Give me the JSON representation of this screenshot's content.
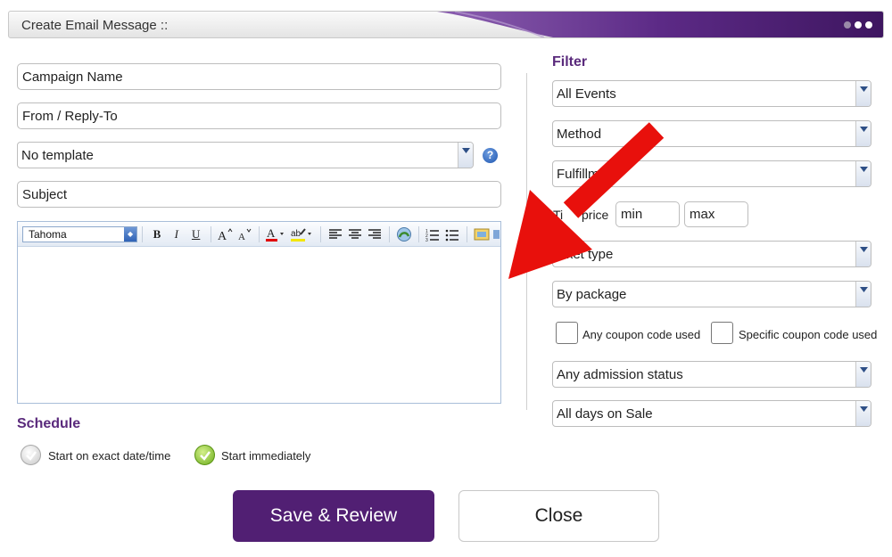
{
  "window": {
    "title": "Create Email Message ::"
  },
  "form": {
    "campaign_name_placeholder": "Campaign Name",
    "from_placeholder": "From / Reply-To",
    "template_value": "No template",
    "subject_placeholder": "Subject",
    "help_glyph": "?"
  },
  "editor": {
    "font_value": "Tahoma",
    "bold_glyph": "B",
    "italic_glyph": "I",
    "underline_glyph": "U"
  },
  "schedule": {
    "heading": "Schedule",
    "option_exact": "Start on exact date/time",
    "option_immediate": "Start immediately",
    "selected": "immediate"
  },
  "filter": {
    "heading": "Filter",
    "events_value": "All Events",
    "method_value": "Method",
    "fulfillment_value": "Fulfillme",
    "ticket_price_label": "Ti",
    "ticket_price_label_tail": "price",
    "min_placeholder": "min",
    "max_placeholder": "max",
    "ticket_type_value": "icket type",
    "package_value": "By package",
    "coupon_any_label": "Any coupon code used",
    "coupon_specific_label": "Specific coupon code used",
    "admission_value": "Any admission status",
    "days_value": "All days on Sale"
  },
  "actions": {
    "save_label": "Save & Review",
    "close_label": "Close"
  },
  "colors": {
    "brand_purple": "#511f73",
    "heading_purple": "#5a2a7c",
    "annotation_red": "#e8100c"
  }
}
